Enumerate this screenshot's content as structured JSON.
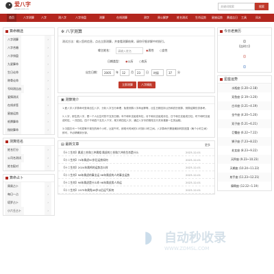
{
  "header": {
    "site_name": "爱八字",
    "site_domain": "aibazi.com.cn",
    "search_placeholder": "关键词搜索",
    "search_button": "搜索"
  },
  "nav": {
    "items": [
      "首页",
      "八字测算",
      "八字",
      "测八字",
      "八字排盘",
      "测算",
      "在线测算",
      "测字",
      "周公解梦",
      "姓名测试",
      "生肖运势",
      "星座运势",
      "黄道吉日",
      "工具",
      "风水"
    ],
    "active_index": 0
  },
  "left": {
    "panel1": {
      "title": "算命精选",
      "items": [
        "八字测算",
        "八字合婚",
        "八字排盘",
        "九星算命",
        "生日论命",
        "称骨论命",
        "号码测吉凶",
        "爱情测试",
        "在线求签",
        "星座运势",
        "纸牌算命",
        "指纹算命"
      ]
    },
    "panel2": {
      "title": "测算姓名",
      "items": [
        "姓名打分",
        "公司名测试",
        "姓名配对"
      ]
    },
    "panel3": {
      "title": "算命占卜",
      "items": [
        "周易占卜",
        "每日一占",
        "塔罗占卜",
        "小六壬占卜"
      ]
    }
  },
  "main": {
    "title": "八字测算",
    "intro": "测试方法：输入您的信息，点击立即测算，并查看测算结果，请你仔细求解中的指引。",
    "name_label": "缘主姓名：",
    "name_placeholder": "请输入姓名",
    "gender_male": "男性",
    "gender_female": "女性",
    "calendar_label": "日期类型：",
    "calendar_solar": "公历",
    "calendar_lunar": "农历",
    "birth_label": "出生日期：",
    "year": "2005",
    "year_unit": "年",
    "month": "12",
    "month_unit": "月",
    "day": "23",
    "day_unit": "日",
    "hour": "时辰",
    "minute": "37",
    "minute_unit": "分",
    "submit": "立即测算",
    "secondary": "八字精批"
  },
  "intro_section": {
    "title": "测算简介",
    "p1": "1.爱八字八字算命可查询出生八字，分析八字五行命理，免费测算八字命运等等，出生日期支持公历和农历测算，测算结果仅供参考。",
    "p2": "2.八字，即生辰八字，是一个人出生时的干支历日期。年干和年支组成年柱，月干和月支组成月柱，日干和日支组成日柱，时干和时支组成时柱，一共四柱。四个干和四个支共八个字，故又称四柱八字。通过八字中的阴阳五行关系推断一生的运程。",
    "p3": "3.中国古代一个时辰等于现在的两个小时，比如午时，即现代时间的11时到13时之间。八字算命只需准确到时辰范围（两个小时之间）即可，不必精确到分钟。"
  },
  "articles": {
    "title": "最新文章",
    "more": "更多",
    "items": [
      {
        "tag": "【十二生肖】",
        "title": "属虎三合和三冲属相 属虎的三合和六冲合生肖是什么",
        "date": "2023-12-01"
      },
      {
        "tag": "【十二生肖】",
        "title": "74年属虎50岁后运势如何",
        "date": "2023-12-01"
      },
      {
        "tag": "【十二生肖】",
        "title": "2024年属鸡的运势怎么样",
        "date": "2023-12-01"
      },
      {
        "tag": "【十二生肖】",
        "title": "98年属虎的事业运 98年属虎的人的事业运势",
        "date": "2023-12-01"
      },
      {
        "tag": "【十二生肖】",
        "title": "98年属虎是什么命 98年属虎男人命运",
        "date": "2023-12-01"
      },
      {
        "tag": "【十二生肖】",
        "title": "1975年属兔48岁以后运气如何",
        "date": "2023-12-01"
      }
    ]
  },
  "right": {
    "today": {
      "title": "今日老黄历",
      "lines": [
        "【】",
        "【吉时二】",
        "【】",
        "【】"
      ]
    },
    "horoscope": {
      "title": "星座运势",
      "items": [
        "水瓶座 (1.20~2.18)",
        "双鱼座 (2.19~3.20)",
        "白羊座 (3.21~4.19)",
        "金牛座 (4.20~5.20)",
        "双子座 (5.21~6.21)",
        "巨蟹座 (6.22~7.22)",
        "狮子座 (7.23~8.22)",
        "处女座 (8.23~9.22)",
        "天秤座 (9.23~10.23)",
        "天蝎座 (10.24~11.22)",
        "射手座 (11.23~12.21)",
        "摩羯座 (12.22~1.19)"
      ]
    }
  },
  "watermark": {
    "text": "自动秒收录",
    "url": "WWW.ZDMSL.COM"
  },
  "colors": {
    "brand_red": "#b3261e",
    "accent_red": "#c0392b"
  }
}
